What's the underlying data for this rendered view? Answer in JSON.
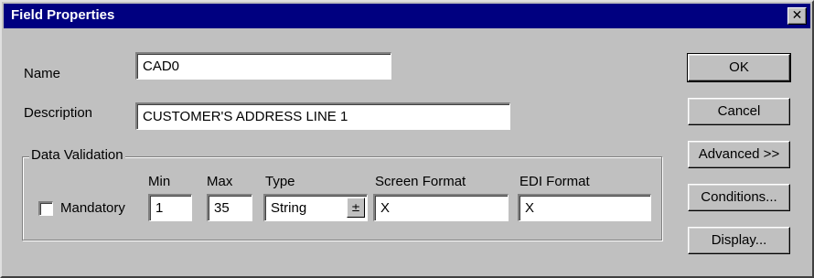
{
  "window": {
    "title": "Field Properties",
    "close_glyph": "✕"
  },
  "form": {
    "name_label": "Name",
    "name_value": "CAD0",
    "description_label": "Description",
    "description_value": "CUSTOMER'S ADDRESS LINE 1"
  },
  "data_validation": {
    "group_title": "Data Validation",
    "mandatory_label": "Mandatory",
    "mandatory_checked": false,
    "min_label": "Min",
    "min_value": "1",
    "max_label": "Max",
    "max_value": "35",
    "type_label": "Type",
    "type_value": "String",
    "type_arrow": "±",
    "screen_format_label": "Screen Format",
    "screen_format_value": "X",
    "edi_format_label": "EDI Format",
    "edi_format_value": "X"
  },
  "buttons": {
    "ok": "OK",
    "cancel": "Cancel",
    "advanced": "Advanced >>",
    "conditions": "Conditions...",
    "display": "Display..."
  },
  "colors": {
    "title_bar": "#000080",
    "face": "#c0c0c0",
    "field": "#ffffff"
  }
}
